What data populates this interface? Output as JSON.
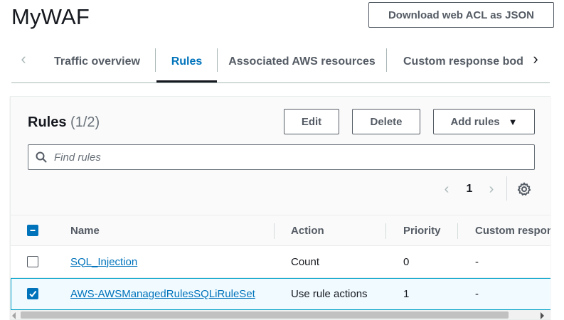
{
  "header": {
    "title": "MyWAF",
    "download_label": "Download web ACL as JSON"
  },
  "tabs": [
    {
      "label": "Traffic overview",
      "active": false
    },
    {
      "label": "Rules",
      "active": true
    },
    {
      "label": "Associated AWS resources",
      "active": false
    },
    {
      "label": "Custom response bodies",
      "active": false
    }
  ],
  "rules_panel": {
    "title": "Rules",
    "count": "(1/2)",
    "edit_label": "Edit",
    "delete_label": "Delete",
    "add_rules_label": "Add rules",
    "search_placeholder": "Find rules",
    "page_number": "1"
  },
  "table": {
    "columns": [
      "Name",
      "Action",
      "Priority",
      "Custom response"
    ],
    "rows": [
      {
        "name": "SQL_Injection",
        "action": "Count",
        "priority": "0",
        "custom_response": "-",
        "selected": false
      },
      {
        "name": "AWS-AWSManagedRulesSQLiRuleSet",
        "action": "Use rule actions",
        "priority": "1",
        "custom_response": "-",
        "selected": true
      }
    ]
  },
  "colors": {
    "accent": "#0073bb",
    "text": "#16191f",
    "muted": "#545b64",
    "selected_row_bg": "#f1faff",
    "selected_row_border": "#00a1c9"
  },
  "icons": {
    "tab_left": "chevron-left-icon",
    "tab_right": "chevron-right-icon",
    "search": "search-icon",
    "settings": "gear-icon",
    "add_rules_caret": "caret-down-icon"
  }
}
